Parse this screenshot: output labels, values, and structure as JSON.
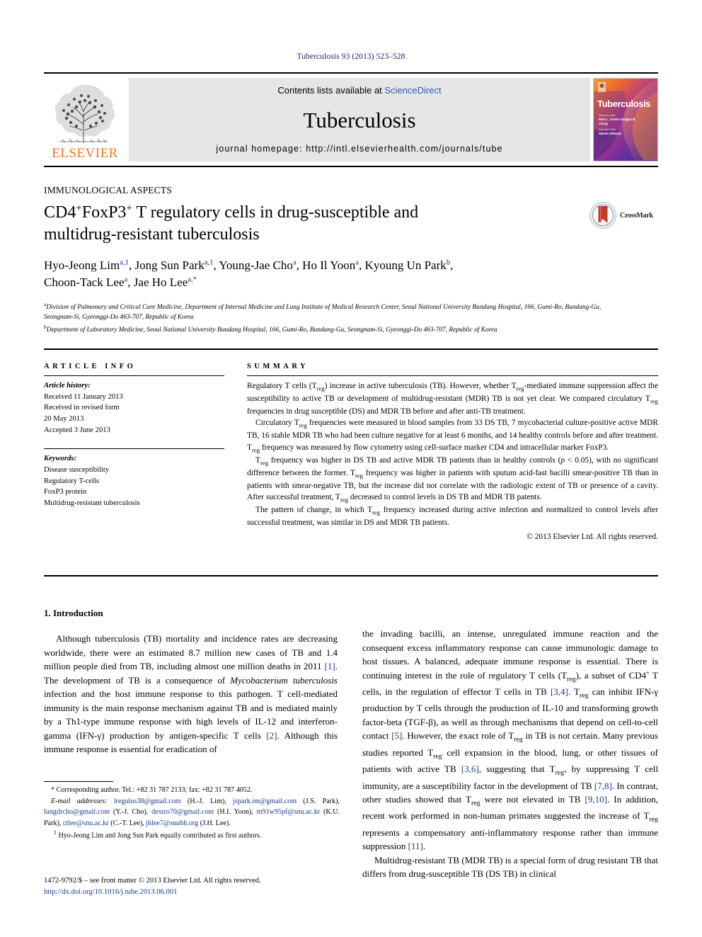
{
  "running_head": "Tuberculosis 93 (2013) 523–528",
  "masthead": {
    "contents_prefix": "Contents lists available at ",
    "sciencedirect": "ScienceDirect",
    "journal_name": "Tuberculosis",
    "homepage": "journal homepage: http://intl.elsevierhealth.com/journals/tube",
    "publisher": "ELSEVIER",
    "cover": {
      "title": "Tuberculosis",
      "editor_label": "Editors-in-Chief",
      "editor_names": "Peter L. Foster\nDouglas B. Young",
      "assoc_label": "Associate Editor",
      "assoc_names": "Steven Gillespie"
    }
  },
  "section_kicker": "IMMUNOLOGICAL ASPECTS",
  "title": {
    "line1_a": "CD4",
    "line1_sup1": "+",
    "line1_b": "FoxP3",
    "line1_sup2": "+",
    "line1_c": " T regulatory cells in drug-susceptible and",
    "line2": "multidrug-resistant tuberculosis"
  },
  "crossmark": {
    "label": "CrossMark"
  },
  "authors": [
    {
      "name": "Hyo-Jeong Lim",
      "marks": "a,1",
      "sep": ", "
    },
    {
      "name": "Jong Sun Park",
      "marks": "a,1",
      "sep": ", "
    },
    {
      "name": "Young-Jae Cho",
      "marks": "a",
      "sep": ", "
    },
    {
      "name": "Ho Il Yoon",
      "marks": "a",
      "sep": ", "
    },
    {
      "name": "Kyoung Un Park",
      "marks": "b",
      "sep": ","
    },
    {
      "name": "Choon-Tack Lee",
      "marks": "a",
      "sep": ", "
    },
    {
      "name": "Jae Ho Lee",
      "marks": "a,*",
      "sep": ""
    }
  ],
  "affiliations": [
    {
      "mark": "a",
      "text": "Division of Pulmonary and Critical Care Medicine, Department of Internal Medicine and Lung Institute of Medical Research Center, Seoul National University Bundang Hospital, 166, Gumi-Ro, Bundang-Gu, Seongnam-Si, Gyeonggi-Do 463-707, Republic of Korea"
    },
    {
      "mark": "b",
      "text": "Department of Laboratory Medicine, Seoul National University Bundang Hospital, 166, Gumi-Ro, Bundang-Gu, Seongnam-Si, Gyeonggi-Do 463-707, Republic of Korea"
    }
  ],
  "article_info": {
    "heading": "ARTICLE INFO",
    "history_label": "Article history:",
    "history": [
      "Received 11 January 2013",
      "Received in revised form",
      "20 May 2013",
      "Accepted 3 June 2013"
    ],
    "keywords_label": "Keywords:",
    "keywords": [
      "Disease susceptibility",
      "Regulatory T-cells",
      "FoxP3 protein",
      "Multidrug-resistant tuberculosis"
    ]
  },
  "summary": {
    "heading": "SUMMARY",
    "paragraphs": [
      "Regulatory T cells (Treg) increase in active tuberculosis (TB). However, whether Treg-mediated immune suppression affect the susceptibility to active TB or development of multidrug-resistant (MDR) TB is not yet clear. We compared circulatory Treg frequencies in drug susceptible (DS) and MDR TB before and after anti-TB treatment.",
      "Circulatory Treg frequencies were measured in blood samples from 33 DS TB, 7 mycobacterial culture-positive active MDR TB, 16 stable MDR TB who had been culture negative for at least 6 months, and 14 healthy controls before and after treatment. Treg frequency was measured by flow cytometry using cell-surface marker CD4 and intracellular marker FoxP3.",
      "Treg frequency was higher in DS TB and active MDR TB patients than in healthy controls (p < 0.05), with no significant difference between the former. Treg frequency was higher in patients with sputum acid-fast bacilli smear-positive TB than in patients with smear-negative TB, but the increase did not correlate with the radiologic extent of TB or presence of a cavity. After successful treatment, Treg decreased to control levels in DS TB and MDR TB patents.",
      "The pattern of change, in which Treg frequency increased during active infection and normalized to control levels after successful treatment, was similar in DS and MDR TB patients."
    ],
    "copyright": "© 2013 Elsevier Ltd. All rights reserved."
  },
  "intro": {
    "heading": "1.  Introduction",
    "left_paragraph": "Although tuberculosis (TB) mortality and incidence rates are decreasing worldwide, there were an estimated 8.7 million new cases of TB and 1.4 million people died from TB, including almost one million deaths in 2011 [1]. The development of TB is a consequence of Mycobacterium tuberculosis infection and the host immune response to this pathogen. T cell-mediated immunity is the main response mechanism against TB and is mediated mainly by a Th1-type immune response with high levels of IL-12 and interferon-gamma (IFN-γ) production by antigen-specific T cells [2]. Although this immune response is essential for eradication of",
    "right_paragraph_1": "the invading bacilli, an intense, unregulated immune reaction and the consequent excess inflammatory response can cause immunologic damage to host tissues. A balanced, adequate immune response is essential. There is continuing interest in the role of regulatory T cells (Treg), a subset of CD4+ T cells, in the regulation of effector T cells in TB [3,4]. Treg can inhibit IFN-γ production by T cells through the production of IL-10 and transforming growth factor-beta (TGF-β), as well as through mechanisms that depend on cell-to-cell contact [5]. However, the exact role of Treg in TB is not certain. Many previous studies reported Treg cell expansion in the blood, lung, or other tissues of patients with active TB [3,6], suggesting that Treg, by suppressing T cell immunity, are a susceptibility factor in the development of TB [7,8]. In contrast, other studies showed that Treg were not elevated in TB [9,10]. In addition, recent work performed in non-human primates suggested the increase of Treg represents a compensatory anti-inflammatory response rather than immune suppression [11].",
    "right_paragraph_2": "Multidrug-resistant TB (MDR TB) is a special form of drug resistant TB that differs from drug-susceptible TB (DS TB) in clinical"
  },
  "footnotes": {
    "corresponding": "* Corresponding author. Tel.: +82 31 787 2133; fax: +82 31 787 4052.",
    "email_label": "E-mail addresses:",
    "emails": [
      {
        "addr": "lregulus38@gmail.com",
        "who": "(H.-J. Lim)"
      },
      {
        "addr": "jspark.im@gmail.com",
        "who": "(J.S. Park)"
      },
      {
        "addr": "lungdrcho@gmail.com",
        "who": "(Y.-J. Cho)"
      },
      {
        "addr": "dextro70@gmail.com",
        "who": "(H.I. Yoon)"
      },
      {
        "addr": "m91w95pf@snu.ac.kr",
        "who": "(K.U. Park)"
      },
      {
        "addr": "ctlee@snu.ac.kr",
        "who": "(C.-T. Lee)"
      },
      {
        "addr": "jhlee7@snubh.org",
        "who": "(J.H. Lee)."
      }
    ],
    "equal_contrib_mark": "1",
    "equal_contrib": "Hyo-Jeong Lim and Jong Sun Park equally contributed as first authors."
  },
  "issn": {
    "line": "1472-9792/$ – see front matter © 2013 Elsevier Ltd. All rights reserved.",
    "doi": "http://dx.doi.org/10.1016/j.tube.2013.06.001"
  },
  "colors": {
    "link": "#1a3a8f",
    "elsevier_orange": "#ef7622",
    "sciencedirect_blue": "#2a5db0",
    "running_head": "#1a1a6e",
    "masthead_bg": "#e6e6e6"
  }
}
